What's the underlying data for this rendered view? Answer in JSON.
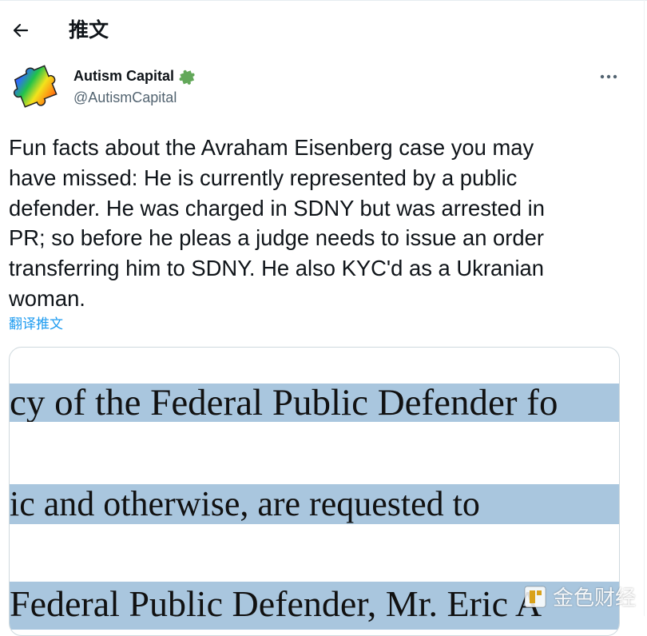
{
  "header": {
    "title": "推文",
    "back_icon": "arrow-left-icon"
  },
  "author": {
    "display_name": "Autism Capital",
    "handle": "@AutismCapital",
    "badge_icon": "puzzle-piece-icon",
    "badge_color": "#63a85a",
    "avatar_icon": "rainbow-puzzle-avatar"
  },
  "tweet": {
    "text": "Fun facts about the Avraham Eisenberg case you may\nhave missed: He is currently represented by a public\ndefender. He was charged in SDNY but was arrested in\nPR; so before he pleas a judge needs to issue an order\ntransferring him to SDNY. He also KYC'd as a Ukranian\nwoman.",
    "translate_label": "翻译推文",
    "more_icon": "more-options-icon"
  },
  "media": {
    "lines": [
      "cy of the Federal Public Defender fo",
      "ic and otherwise, are requested to",
      "Federal Public Defender, Mr. Eric A"
    ],
    "highlight_color": "#a9c6de"
  },
  "watermark": {
    "text": "金色财经",
    "logo_icon": "jinse-logo-icon"
  },
  "colors": {
    "link": "#1d9bf0",
    "secondary_text": "#536471",
    "border": "#cfd9de"
  }
}
